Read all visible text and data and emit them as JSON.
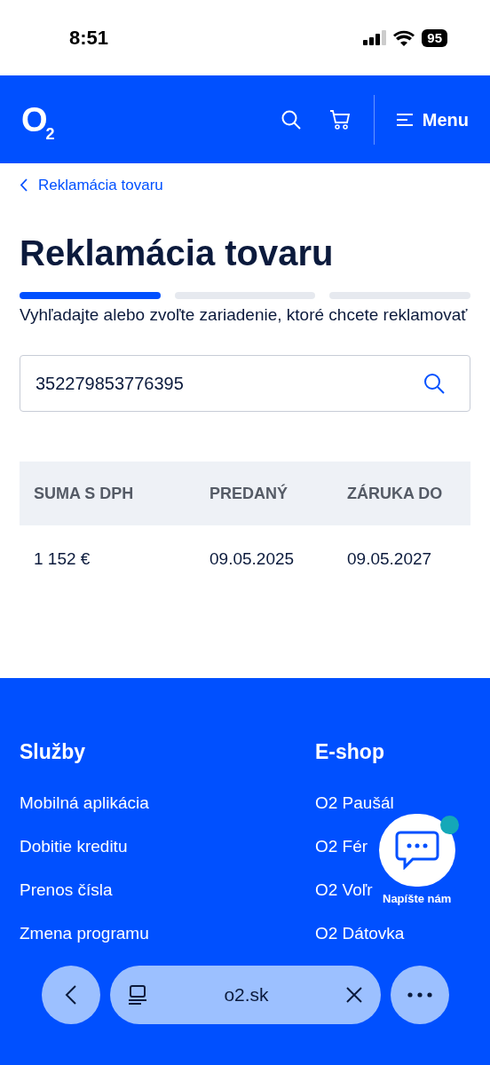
{
  "status_bar": {
    "time": "8:51",
    "battery": "95"
  },
  "header": {
    "logo": "O",
    "logo_sub": "2",
    "menu_label": "Menu"
  },
  "breadcrumb": {
    "label": "Reklamácia tovaru"
  },
  "title": "Reklamácia tovaru",
  "steps": [
    {
      "selected": true
    },
    {
      "selected": false
    },
    {
      "selected": false
    }
  ],
  "instruction": "Vyhľadajte alebo zvoľte zariadenie, ktoré chcete reklamovať",
  "search": {
    "value": "352279853776395"
  },
  "table": {
    "columns": [
      "SUMA S DPH",
      "PREDANÝ",
      "ZÁRUKA DO"
    ],
    "rows": [
      [
        "1 152 €",
        "09.05.2025",
        "09.05.2027"
      ]
    ]
  },
  "footer": {
    "columns": [
      {
        "heading": "Služby",
        "links": [
          "Mobilná aplikácia",
          "Dobitie kreditu",
          "Prenos čísla",
          "Zmena programu"
        ]
      },
      {
        "heading": "E-shop",
        "links": [
          "O2 Paušál",
          "O2 Fér",
          "O2 Voľr",
          "O2 Dátovka"
        ]
      }
    ]
  },
  "chat": {
    "label": "Napíšte nám",
    "online": true
  },
  "browser_bar": {
    "url": "o2.sk"
  }
}
